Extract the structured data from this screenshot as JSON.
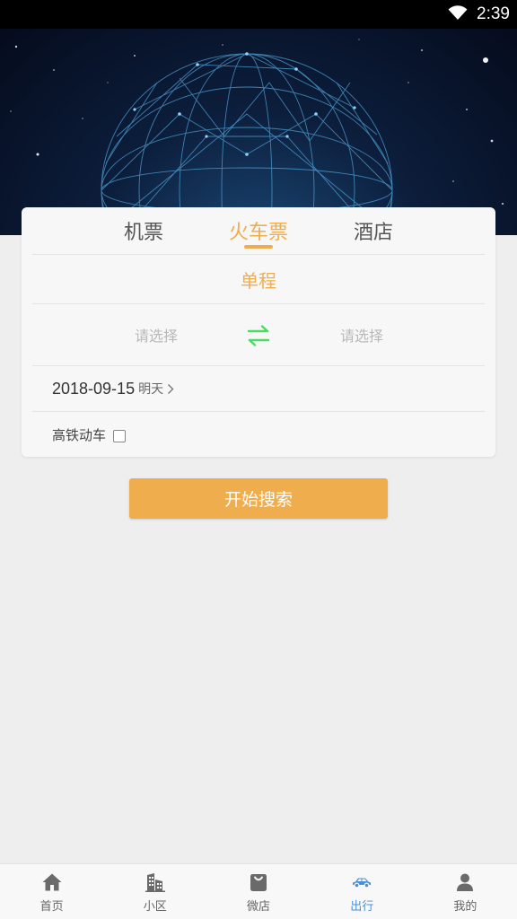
{
  "status_bar": {
    "time": "2:39",
    "wifi_icon": "wifi-icon"
  },
  "tabs": [
    {
      "label": "机票",
      "active": false
    },
    {
      "label": "火车票",
      "active": true
    },
    {
      "label": "酒店",
      "active": false
    }
  ],
  "trip_type": "单程",
  "stations": {
    "from_placeholder": "请选择",
    "to_placeholder": "请选择",
    "swap_icon": "swap-arrows-icon"
  },
  "date": {
    "value": "2018-09-15",
    "relative": "明天"
  },
  "high_speed": {
    "label": "高铁动车",
    "checked": false
  },
  "search_button": "开始搜索",
  "bottom_nav": [
    {
      "label": "首页",
      "icon": "home-icon",
      "active": false
    },
    {
      "label": "小区",
      "icon": "building-icon",
      "active": false
    },
    {
      "label": "微店",
      "icon": "shopping-bag-icon",
      "active": false
    },
    {
      "label": "出行",
      "icon": "car-icon",
      "active": true
    },
    {
      "label": "我的",
      "icon": "person-icon",
      "active": false
    }
  ],
  "colors": {
    "accent": "#f0ad4e",
    "nav_active": "#4a8fd8",
    "swap": "#4cd964"
  }
}
